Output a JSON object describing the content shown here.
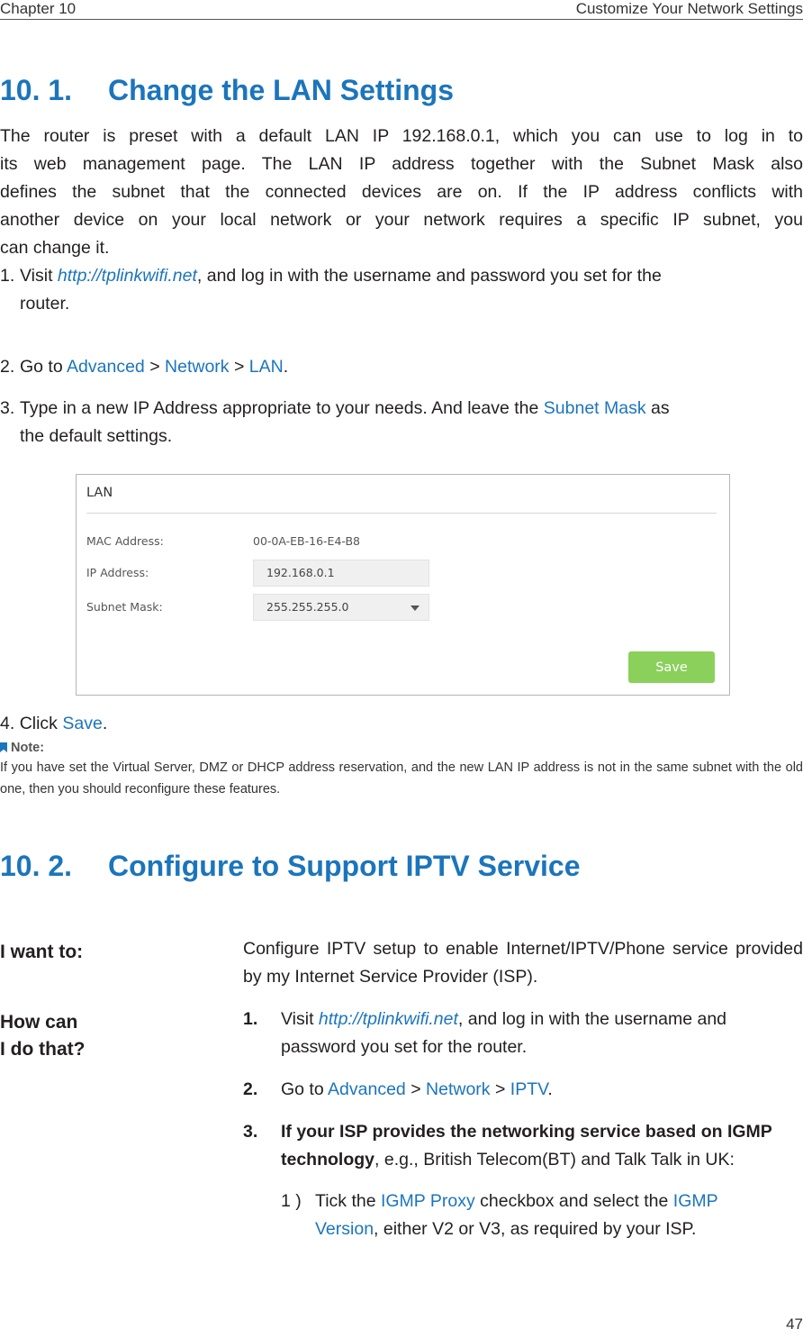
{
  "header": {
    "chapter": "Chapter 10",
    "title": "Customize Your Network Settings"
  },
  "section1": {
    "number": "10. 1.",
    "title": "Change the LAN Settings",
    "intro_lines": [
      "The router is preset with a default LAN IP 192.168.0.1, which you can use to log in to",
      "its web management page. The LAN IP address together with the Subnet Mask also",
      "defines the subnet that the connected devices are on. If the IP address conflicts with",
      "another device on your local network or your network requires a specific IP subnet, you",
      "can change it."
    ],
    "steps": {
      "s1": {
        "num": "1.",
        "pre": "Visit ",
        "link": "http://tplinkwifi.net",
        "post": ", and log in with the username and password you set for the",
        "cont": "router."
      },
      "s2": {
        "num": "2.",
        "pre": "Go to ",
        "p1": "Advanced",
        "sep1": " > ",
        "p2": "Network",
        "sep2": " > ",
        "p3": "LAN",
        "post": "."
      },
      "s3": {
        "num": "3.",
        "pre": "Type in a new IP Address appropriate to your needs. And leave the ",
        "hl": "Subnet Mask",
        "post": " as",
        "cont": "the default settings."
      },
      "s4": {
        "num": "4.",
        "pre": "Click ",
        "hl": "Save",
        "post": "."
      }
    },
    "lan_panel": {
      "title": "LAN",
      "mac_label": "MAC Address:",
      "mac_value": "00-0A-EB-16-E4-B8",
      "ip_label": "IP Address:",
      "ip_value": "192.168.0.1",
      "mask_label": "Subnet Mask:",
      "mask_value": "255.255.255.0",
      "save_label": "Save",
      "save_color": "#8bd05a"
    },
    "note": {
      "label": "Note:",
      "text": "If you have set the Virtual Server, DMZ or DHCP address reservation, and the new LAN IP address is not in the same subnet with the old one, then you should reconfigure these features."
    }
  },
  "section2": {
    "number": "10. 2.",
    "title": "Configure to Support IPTV Service",
    "want_label": "I want to:",
    "want_text": "Configure IPTV setup to enable Internet/IPTV/Phone service provided by my Internet Service Provider (ISP).",
    "how_label_1": "How can",
    "how_label_2": "I do that?",
    "steps": {
      "s1": {
        "num": "1.",
        "pre": "Visit ",
        "link": "http://tplinkwifi.net",
        "post": ", and log in with the username and",
        "cont": "password you set for the router."
      },
      "s2": {
        "num": "2.",
        "pre": "Go to ",
        "p1": "Advanced",
        "sep1": " > ",
        "p2": "Network",
        "sep2": " > ",
        "p3": "IPTV",
        "post": "."
      },
      "s3": {
        "num": "3.",
        "bold": "If your ISP provides the networking service based on IGMP",
        "bold2": "technology",
        "post": ", e.g., British Telecom(BT) and Talk Talk in UK:"
      },
      "sub1": {
        "num": "1 )",
        "pre": "Tick the ",
        "hl1": "IGMP Proxy",
        "mid": " checkbox and select the ",
        "hl2": "IGMP",
        "hl3": "Version",
        "post": ", either V2 or V3, as required by your ISP."
      }
    }
  },
  "accent_color": "#1b75bc",
  "page_number": "47"
}
